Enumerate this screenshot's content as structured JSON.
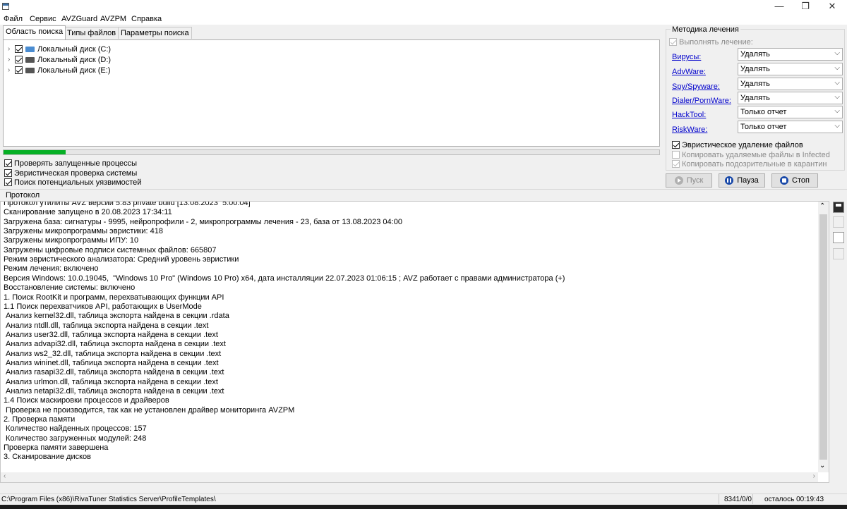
{
  "window": {
    "minimize": "—",
    "maximize": "❐",
    "close": "✕"
  },
  "menu": [
    "Файл",
    "Сервис",
    "AVZGuard",
    "AVZPM",
    "Справка"
  ],
  "tabs": [
    "Область поиска",
    "Типы файлов",
    "Параметры поиска"
  ],
  "drives": [
    "Локальный диск (C:)",
    "Локальный диск (D:)",
    "Локальный диск  (E:)"
  ],
  "progress": 0.095,
  "options": [
    {
      "label": "Проверять запущенные процессы",
      "checked": true
    },
    {
      "label": "Эвристическая проверка системы",
      "checked": true
    },
    {
      "label": "Поиск потенциальных уязвимостей",
      "checked": true
    }
  ],
  "method": {
    "title": "Методика лечения",
    "perform": "Выполнять лечение:",
    "rows": [
      {
        "label": "Вирусы:",
        "value": "Удалять"
      },
      {
        "label": "AdvWare:",
        "value": "Удалять"
      },
      {
        "label": "Spy/Spyware:",
        "value": "Удалять"
      },
      {
        "label": "Dialer/PornWare:",
        "value": "Удалять"
      },
      {
        "label": "HackTool:",
        "value": "Только отчет"
      },
      {
        "label": "RiskWare:",
        "value": "Только отчет"
      }
    ],
    "heuristic_delete": "Эвристическое удаление файлов",
    "copy_deleted": "Копировать удаляемые файлы в  Infected",
    "copy_suspicious": "Копировать подозрительные в  карантин"
  },
  "buttons": {
    "start": "Пуск",
    "pause": "Пауза",
    "stop": "Стоп"
  },
  "protocol": {
    "label": "Протокол",
    "lines": [
      "Протокол утилиты AVZ версии 5.83 private build [13.08.2023  5:00:04]",
      "Сканирование запущено в 20.08.2023 17:34:11",
      "Загружена база: сигнатуры - 9995, нейропрофили - 2, микропрограммы лечения - 23, база от 13.08.2023 04:00",
      "Загружены микропрограммы эвристики: 418",
      "Загружены микропрограммы ИПУ: 10",
      "Загружены цифровые подписи системных файлов: 665807",
      "Режим эвристического анализатора: Средний уровень эвристики",
      "Режим лечения: включено",
      "Версия Windows: 10.0.19045,  \"Windows 10 Pro\" (Windows 10 Pro) x64, дата инсталляции 22.07.2023 01:06:15 ; AVZ работает с правами администратора (+)",
      "Восстановление системы: включено",
      "1. Поиск RootKit и программ, перехватывающих функции API",
      "1.1 Поиск перехватчиков API, работающих в UserMode",
      " Анализ kernel32.dll, таблица экспорта найдена в секции .rdata",
      " Анализ ntdll.dll, таблица экспорта найдена в секции .text",
      " Анализ user32.dll, таблица экспорта найдена в секции .text",
      " Анализ advapi32.dll, таблица экспорта найдена в секции .text",
      " Анализ ws2_32.dll, таблица экспорта найдена в секции .text",
      " Анализ wininet.dll, таблица экспорта найдена в секции .text",
      " Анализ rasapi32.dll, таблица экспорта найдена в секции .text",
      " Анализ urlmon.dll, таблица экспорта найдена в секции .text",
      " Анализ netapi32.dll, таблица экспорта найдена в секции .text",
      "1.4 Поиск маскировки процессов и драйверов",
      " Проверка не производится, так как не установлен драйвер мониторинга AVZPM",
      "2. Проверка памяти",
      " Количество найденных процессов: 157",
      " Количество загруженных модулей: 248",
      "Проверка памяти завершена",
      "3. Сканирование дисков"
    ]
  },
  "status": {
    "path": "C:\\Program Files (x86)\\RivaTuner Statistics Server\\ProfileTemplates\\",
    "counter": "8341/0/0",
    "remaining": "осталось 00:19:43"
  }
}
